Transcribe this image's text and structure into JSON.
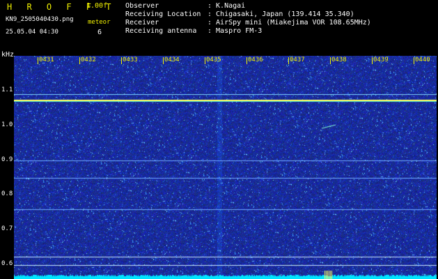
{
  "header": {
    "app_title": "H R O F F T",
    "version": "1.00f",
    "file_name": "KN9_2505040430.png",
    "datetime": "25.05.04 04:30",
    "counter_label": "meteor",
    "counter_value": "6",
    "info": [
      {
        "key": "Observer",
        "value": ": K.Nagai"
      },
      {
        "key": "Receiving Location",
        "value": ": Chigasaki, Japan (139.414 35.340)"
      },
      {
        "key": "Receiver",
        "value": ": AirSpy mini (Miakejima VOR 108.65MHz)"
      },
      {
        "key": "Receiving antenna",
        "value": ": Maspro FM-3"
      }
    ]
  },
  "axis": {
    "unit": "kHz",
    "freq_labels": [
      "1.1",
      "1.0",
      "0.9",
      "0.8",
      "0.7",
      "0.6"
    ],
    "time_labels": [
      "0431",
      "0432",
      "0433",
      "0434",
      "0435",
      "0436",
      "0437",
      "0438",
      "0439",
      "0440"
    ]
  },
  "colors": {
    "background": "#000000",
    "waterfall_base": "#1a2a99",
    "label_yellow": "#f2f200",
    "label_white": "#ffffff",
    "carrier": "#ffff60"
  }
}
